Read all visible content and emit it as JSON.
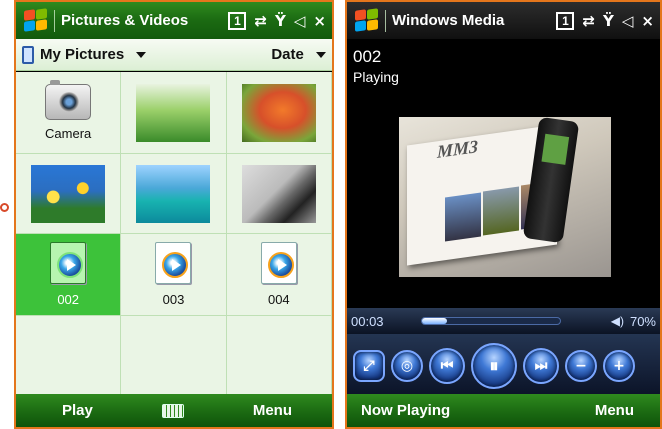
{
  "left": {
    "status": {
      "title": "Pictures & Videos",
      "badge": "1",
      "close": "×"
    },
    "folder": {
      "name": "My Pictures",
      "sort": "Date"
    },
    "items": [
      {
        "label": "Camera"
      },
      {
        "label": ""
      },
      {
        "label": ""
      },
      {
        "label": ""
      },
      {
        "label": ""
      },
      {
        "label": ""
      },
      {
        "label": "002"
      },
      {
        "label": "003"
      },
      {
        "label": "004"
      }
    ],
    "softkeys": {
      "left": "Play",
      "right": "Menu"
    },
    "colors": {
      "accent": "#3dc23a",
      "bar": "#1b6a12",
      "border": "#e4761c"
    }
  },
  "right": {
    "status": {
      "title": "Windows Media",
      "badge": "1",
      "close": "×"
    },
    "track": {
      "title": "002",
      "state": "Playing"
    },
    "video": {
      "overlay_text": "MM3"
    },
    "seek": {
      "time": "00:03",
      "progress_fraction": 0.18
    },
    "volume": {
      "label": "70%"
    },
    "softkeys": {
      "left": "Now Playing",
      "right": "Menu"
    },
    "colors": {
      "accent": "#3f79d6",
      "bar": "#0b1324"
    }
  }
}
